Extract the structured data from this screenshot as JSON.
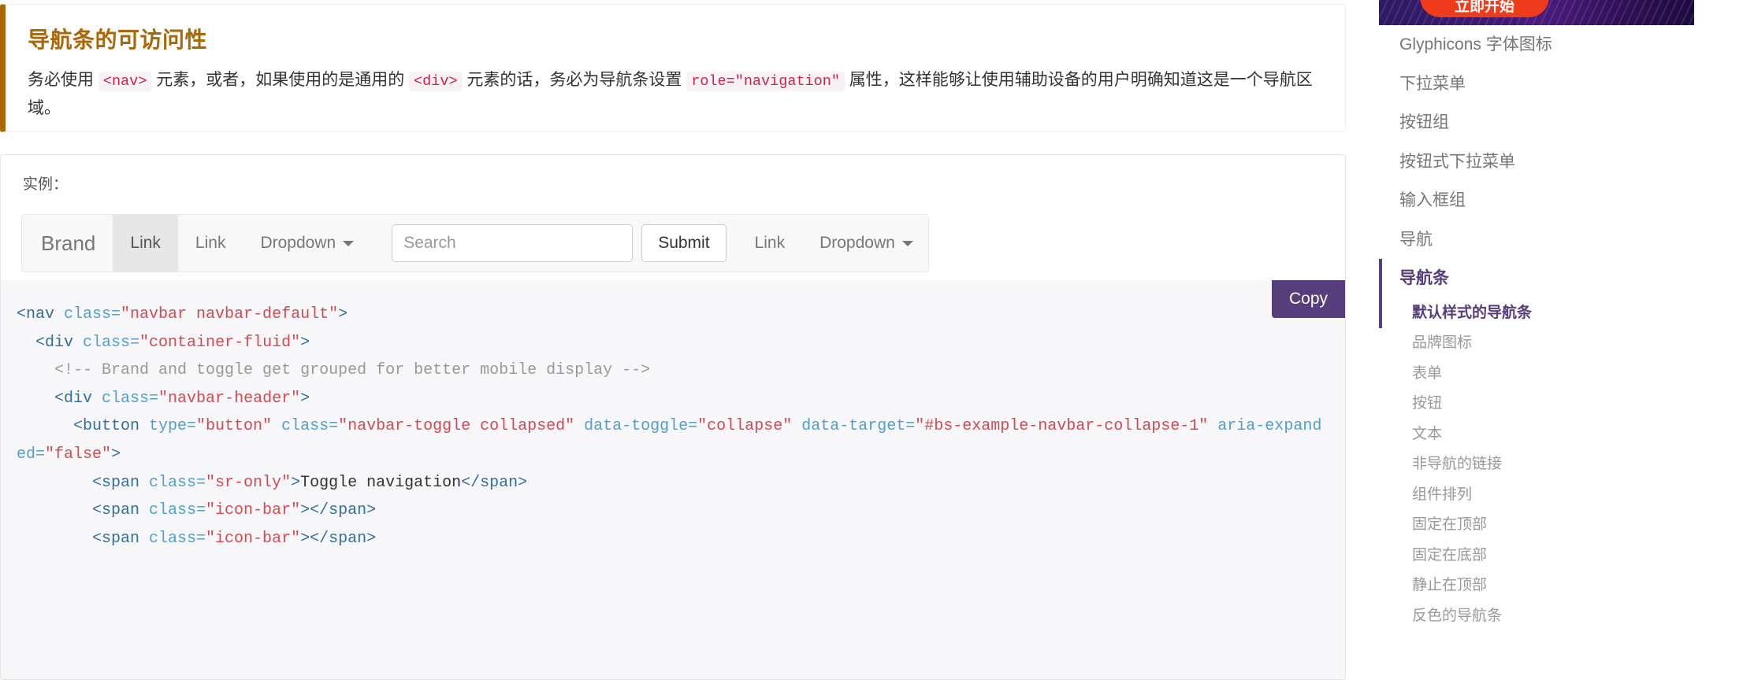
{
  "callout": {
    "title": "导航条的可访问性",
    "body_parts": [
      {
        "type": "text",
        "value": "务必使用 "
      },
      {
        "type": "code",
        "value": "<nav>"
      },
      {
        "type": "text",
        "value": " 元素，或者，如果使用的是通用的 "
      },
      {
        "type": "code",
        "value": "<div>"
      },
      {
        "type": "text",
        "value": " 元素的话，务必为导航条设置 "
      },
      {
        "type": "code",
        "value": "role=\"navigation\""
      },
      {
        "type": "text",
        "value": " 属性，这样能够让使用辅助设备的用户明确知道这是一个导航区域。"
      }
    ],
    "accent_color": "#aa6708"
  },
  "example": {
    "label": "实例：",
    "navbar": {
      "brand": "Brand",
      "left_items": [
        {
          "label": "Link",
          "active": true,
          "dropdown": false
        },
        {
          "label": "Link",
          "active": false,
          "dropdown": false
        },
        {
          "label": "Dropdown",
          "active": false,
          "dropdown": true
        }
      ],
      "search_placeholder": "Search",
      "search_value": "",
      "submit_label": "Submit",
      "right_items": [
        {
          "label": "Link",
          "active": false,
          "dropdown": false
        },
        {
          "label": "Dropdown",
          "active": false,
          "dropdown": true
        }
      ]
    }
  },
  "code": {
    "copy_label": "Copy",
    "lines": [
      [
        {
          "t": "tag",
          "v": "<nav "
        },
        {
          "t": "attr",
          "v": "class="
        },
        {
          "t": "str",
          "v": "\"navbar navbar-default\""
        },
        {
          "t": "tag",
          "v": ">"
        }
      ],
      [
        {
          "t": "txt",
          "v": "  "
        },
        {
          "t": "tag",
          "v": "<div "
        },
        {
          "t": "attr",
          "v": "class="
        },
        {
          "t": "str",
          "v": "\"container-fluid\""
        },
        {
          "t": "tag",
          "v": ">"
        }
      ],
      [
        {
          "t": "cmt",
          "v": "    <!-- Brand and toggle get grouped for better mobile display -->"
        }
      ],
      [
        {
          "t": "txt",
          "v": "    "
        },
        {
          "t": "tag",
          "v": "<div "
        },
        {
          "t": "attr",
          "v": "class="
        },
        {
          "t": "str",
          "v": "\"navbar-header\""
        },
        {
          "t": "tag",
          "v": ">"
        }
      ],
      [
        {
          "t": "txt",
          "v": "      "
        },
        {
          "t": "tag",
          "v": "<button "
        },
        {
          "t": "attr",
          "v": "type="
        },
        {
          "t": "str",
          "v": "\"button\""
        },
        {
          "t": "attr",
          "v": " class="
        },
        {
          "t": "str",
          "v": "\"navbar-toggle collapsed\""
        },
        {
          "t": "attr",
          "v": " data-toggle="
        },
        {
          "t": "str",
          "v": "\"collapse\""
        },
        {
          "t": "attr",
          "v": " data-target="
        },
        {
          "t": "str",
          "v": "\"#bs-example-navbar-collapse-1\""
        },
        {
          "t": "attr",
          "v": " aria-expanded="
        },
        {
          "t": "str",
          "v": "\"false\""
        },
        {
          "t": "tag",
          "v": ">"
        }
      ],
      [
        {
          "t": "txt",
          "v": "        "
        },
        {
          "t": "tag",
          "v": "<span "
        },
        {
          "t": "attr",
          "v": "class="
        },
        {
          "t": "str",
          "v": "\"sr-only\""
        },
        {
          "t": "tag",
          "v": ">"
        },
        {
          "t": "txt",
          "v": "Toggle navigation"
        },
        {
          "t": "tag",
          "v": "</span>"
        }
      ],
      [
        {
          "t": "txt",
          "v": "        "
        },
        {
          "t": "tag",
          "v": "<span "
        },
        {
          "t": "attr",
          "v": "class="
        },
        {
          "t": "str",
          "v": "\"icon-bar\""
        },
        {
          "t": "tag",
          "v": ">"
        },
        {
          "t": "tag",
          "v": "</span>"
        }
      ],
      [
        {
          "t": "txt",
          "v": "        "
        },
        {
          "t": "tag",
          "v": "<span "
        },
        {
          "t": "attr",
          "v": "class="
        },
        {
          "t": "str",
          "v": "\"icon-bar\""
        },
        {
          "t": "tag",
          "v": ">"
        },
        {
          "t": "tag",
          "v": "</span>"
        }
      ]
    ]
  },
  "sidebar": {
    "ad": {
      "cta_label": "立即开始"
    },
    "items": [
      {
        "label": "Glyphicons 字体图标",
        "active": false
      },
      {
        "label": "下拉菜单",
        "active": false
      },
      {
        "label": "按钮组",
        "active": false
      },
      {
        "label": "按钮式下拉菜单",
        "active": false
      },
      {
        "label": "输入框组",
        "active": false
      },
      {
        "label": "导航",
        "active": false
      },
      {
        "label": "导航条",
        "active": true
      }
    ],
    "sub_items": [
      {
        "label": "默认样式的导航条",
        "active": true
      },
      {
        "label": "品牌图标",
        "active": false
      },
      {
        "label": "表单",
        "active": false
      },
      {
        "label": "按钮",
        "active": false
      },
      {
        "label": "文本",
        "active": false
      },
      {
        "label": "非导航的链接",
        "active": false
      },
      {
        "label": "组件排列",
        "active": false
      },
      {
        "label": "固定在顶部",
        "active": false
      },
      {
        "label": "固定在底部",
        "active": false
      },
      {
        "label": "静止在顶部",
        "active": false
      },
      {
        "label": "反色的导航条",
        "active": false
      }
    ]
  },
  "colors": {
    "brand_purple": "#563d7c",
    "warning_orange": "#aa6708",
    "code_pink": "#c7254e"
  }
}
